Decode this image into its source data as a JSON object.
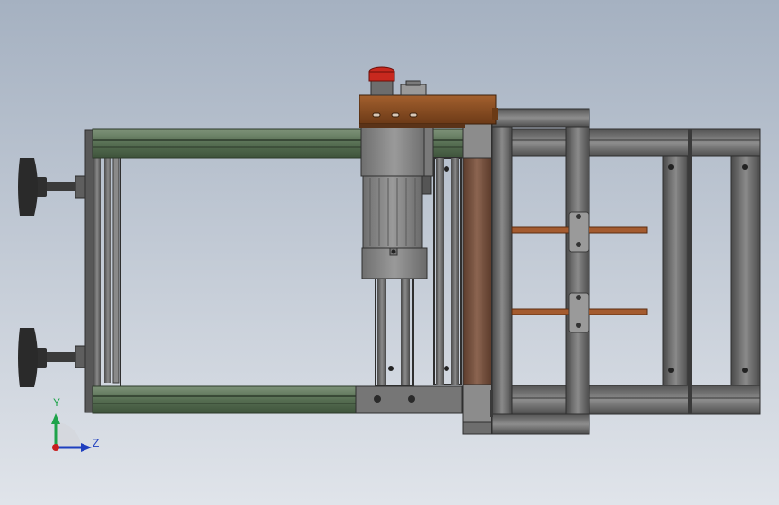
{
  "triad": {
    "y_label": "Y",
    "z_label": "Z"
  },
  "colors": {
    "background_top": "#a7b3c2",
    "background_bottom": "#dfe3e9",
    "rail_green": "#5b7357",
    "frame_grey": "#6e6e6e",
    "frame_dark": "#3f3f3f",
    "bronze_box": "#8a4d22",
    "roller": "#7a5440",
    "rod_copper": "#a45b2f",
    "estop_red": "#c8281e",
    "foot_black": "#2a2a2a",
    "axis_y": "#1ea34a",
    "axis_z": "#1f3fbf",
    "axis_origin": "#c81e1e"
  },
  "icons": {
    "triad": "xyz-axis-triad-icon",
    "estop": "emergency-stop-icon"
  }
}
